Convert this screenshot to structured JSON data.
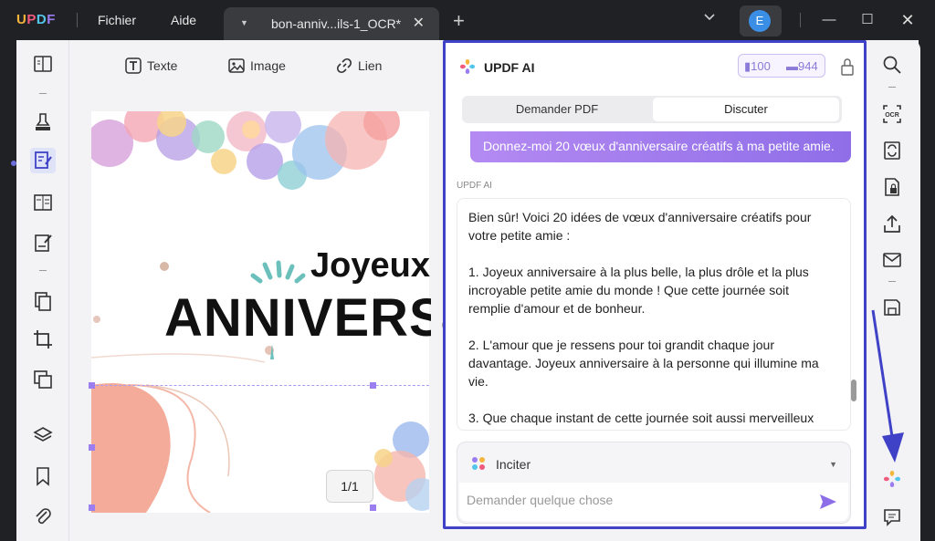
{
  "app": {
    "logo": "UPDF"
  },
  "menu": {
    "file": "Fichier",
    "help": "Aide"
  },
  "tab": {
    "title": "bon-anniv...ils-1_OCR*"
  },
  "user": {
    "initial": "E"
  },
  "toolbar": {
    "text": "Texte",
    "image": "Image",
    "link": "Lien"
  },
  "document": {
    "heading1": "Joyeux",
    "heading2": "ANNIVERS",
    "page_indicator": "1/1"
  },
  "ai": {
    "title": "UPDF AI",
    "credits_pdf": "100",
    "credits_chat": "944",
    "tab_ask_pdf": "Demander PDF",
    "tab_chat": "Discuter",
    "user_message": "Donnez-moi 20 vœux d'anniversaire créatifs à ma petite amie.",
    "sender_label": "UPDF AI",
    "answer_paragraphs": [
      "Bien sûr! Voici 20 idées de vœux d'anniversaire créatifs pour votre petite amie :",
      "1. Joyeux anniversaire à la plus belle, la plus drôle et la plus incroyable petite amie du monde ! Que cette journée soit remplie d'amour et de bonheur.",
      "2. L'amour que je ressens pour toi grandit chaque jour davantage. Joyeux anniversaire à la personne qui illumine ma vie.",
      "3. Que chaque instant de cette journée soit aussi merveilleux"
    ],
    "prompt_selector": "Inciter",
    "input_placeholder": "Demander quelque chose"
  },
  "colors": {
    "accent": "#3f42c6",
    "bubble": "#a37cf0",
    "brand_purple": "#8b6ee8"
  }
}
